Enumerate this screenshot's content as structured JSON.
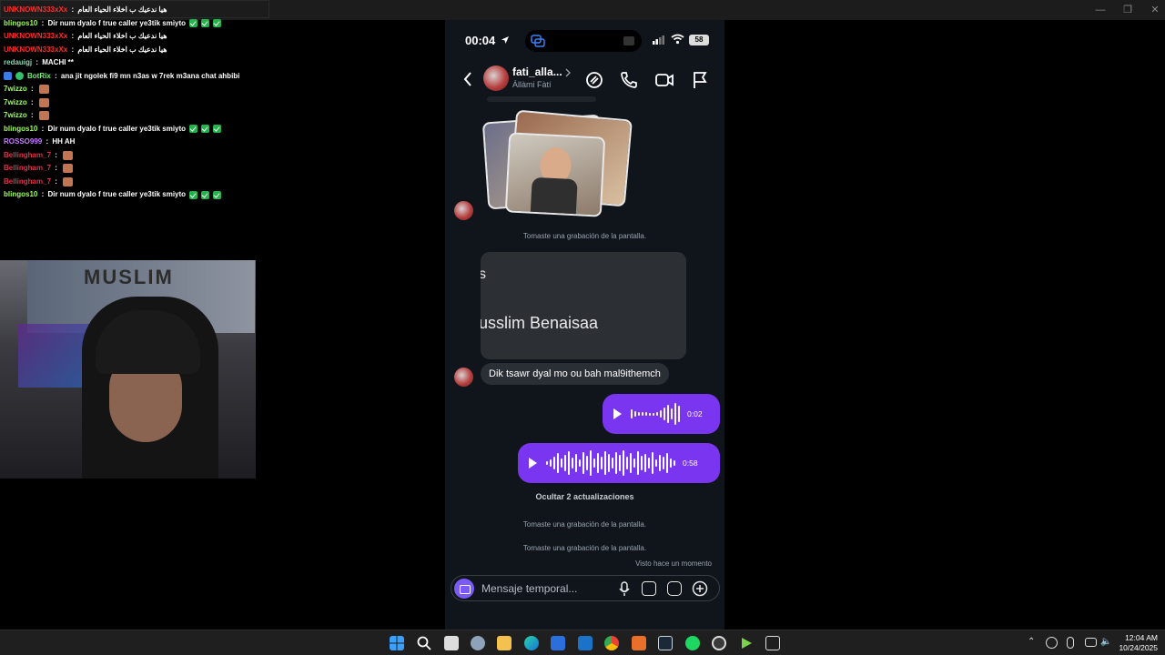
{
  "chat": {
    "lines": [
      {
        "user": "UNKNOWN333xXx",
        "color": "#ff2b2b",
        "sep": " : ",
        "msg": "هيا ندعيك ب اخلاء الحياء العام",
        "chips": 0,
        "sticker": false
      },
      {
        "user": "blingos10",
        "color": "#9cff5a",
        "sep": " : ",
        "msg": "Dir num dyalo f true caller ye3tik smiyto",
        "chips": 3,
        "sticker": false
      },
      {
        "user": "UNKNOWN333xXx",
        "color": "#ff2b2b",
        "sep": " : ",
        "msg": "هيا ندعيك ب اخلاء الحياء العام",
        "chips": 0,
        "sticker": false
      },
      {
        "user": "UNKNOWN333xXx",
        "color": "#ff2b2b",
        "sep": " : ",
        "msg": "هيا ندعيك ب اخلاء الحياء العام",
        "chips": 0,
        "sticker": false
      },
      {
        "user": "redauigj",
        "color": "#8fd6b6",
        "sep": " : ",
        "msg": "MACHI **",
        "chips": 0,
        "sticker": false
      },
      {
        "user": "BotRix",
        "color": "#7be87b",
        "sep": " : ",
        "msg": "ana  jit ngolek fi9 mn n3as w 7rek m3ana chat ahbibi",
        "chips": 0,
        "sticker": false,
        "badges": true
      },
      {
        "user": "7wizzo",
        "color": "#9cff5a",
        "sep": " : ",
        "msg": "",
        "chips": 0,
        "sticker": true
      },
      {
        "user": "7wizzo",
        "color": "#9cff5a",
        "sep": " : ",
        "msg": "",
        "chips": 0,
        "sticker": true
      },
      {
        "user": "7wizzo",
        "color": "#9cff5a",
        "sep": " : ",
        "msg": "",
        "chips": 0,
        "sticker": true
      },
      {
        "user": "blingos10",
        "color": "#9cff5a",
        "sep": " : ",
        "msg": "Dir num dyalo f true caller ye3tik smiyto",
        "chips": 3,
        "sticker": false
      },
      {
        "user": "ROSSO999",
        "color": "#c77dff",
        "sep": " : ",
        "msg": "HH AH",
        "chips": 0,
        "sticker": false
      },
      {
        "user": "Bellingham_7",
        "color": "#e0304a",
        "sep": " : ",
        "msg": "",
        "chips": 0,
        "sticker": true
      },
      {
        "user": "Bellingham_7",
        "color": "#e0304a",
        "sep": " : ",
        "msg": "",
        "chips": 0,
        "sticker": true
      },
      {
        "user": "Bellingham_7",
        "color": "#e0304a",
        "sep": " : ",
        "msg": "",
        "chips": 0,
        "sticker": true
      },
      {
        "user": "blingos10",
        "color": "#9cff5a",
        "sep": " : ",
        "msg": "Dir num dyalo f true caller ye3tik smiyto",
        "chips": 3,
        "sticker": false
      }
    ]
  },
  "phone": {
    "time": "00:04",
    "battery": "58",
    "contact_name": "fati_alla...",
    "contact_sub": "Állàmi Fàtí",
    "sys_screen_rec": "Tomaste una grabación de la pantalla.",
    "card_initial": "s",
    "card_name": "usslim Benaisaa",
    "incoming_msg": "Dik tsawr dyal mo ou bah mal9ithemch",
    "voice1_duration": "0:02",
    "voice2_duration": "0:58",
    "hide_updates": "Ocultar 2 actualizaciones",
    "seen": "Visto hace un momento",
    "composer_placeholder": "Mensaje temporal..."
  },
  "taskbar": {
    "clock_time": "12:04 AM",
    "clock_date": "10/24/2025"
  },
  "colors": {
    "voice_bubble": "#7a35f0",
    "composer_camera": "#7a5af8",
    "phone_bg": "#10151c"
  }
}
